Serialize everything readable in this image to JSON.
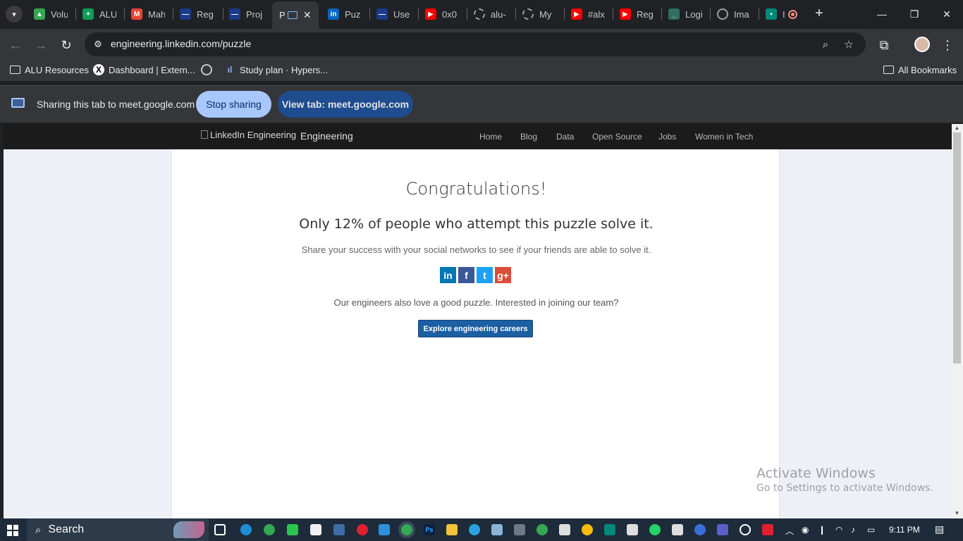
{
  "browser": {
    "tabs": [
      {
        "title": "Volu",
        "icon": "google-drive-icon",
        "color": "#34a853"
      },
      {
        "title": "ALU",
        "icon": "google-sheets-icon",
        "color": "#0f9d58"
      },
      {
        "title": "Mah",
        "icon": "gmail-icon",
        "color": "#ea4335"
      },
      {
        "title": "Reg",
        "icon": "site-icon",
        "color": "#1a3a8a"
      },
      {
        "title": "Proj",
        "icon": "site-icon",
        "color": "#1a3a8a"
      },
      {
        "title": "P",
        "icon": "present-icon",
        "color": "#8ab4f8",
        "active": true
      },
      {
        "title": "Puz",
        "icon": "linkedin-icon",
        "color": "#0a66c2"
      },
      {
        "title": "Use",
        "icon": "site-icon",
        "color": "#1a3a8a"
      },
      {
        "title": "0x0",
        "icon": "youtube-icon",
        "color": "#ff0000"
      },
      {
        "title": "alu-",
        "icon": "loading-icon",
        "color": "#9aa0a6"
      },
      {
        "title": "My",
        "icon": "loading-icon",
        "color": "#9aa0a6"
      },
      {
        "title": "#alx",
        "icon": "youtube-icon",
        "color": "#ff0000"
      },
      {
        "title": "Reg",
        "icon": "youtube-icon",
        "color": "#ff0000"
      },
      {
        "title": "Logi",
        "icon": "site-icon",
        "color": "#2f6f62"
      },
      {
        "title": "Ima",
        "icon": "globe-icon",
        "color": "#9aa0a6"
      },
      {
        "title": "I",
        "icon": "google-meet-icon",
        "color": "#00897b"
      }
    ],
    "url": "engineering.linkedin.com/puzzle",
    "bookmarks": [
      {
        "label": "ALU Resources",
        "icon": "folder-icon"
      },
      {
        "label": "Dashboard | Extern...",
        "icon": "x-icon"
      },
      {
        "label": "",
        "icon": "globe-icon"
      },
      {
        "label": "Study plan · Hypers...",
        "icon": "hyperskill-icon"
      }
    ],
    "all_bookmarks": "All Bookmarks"
  },
  "sharing": {
    "text": "Sharing this tab to meet.google.com",
    "stop_label": "Stop sharing",
    "view_label": "View tab: meet.google.com"
  },
  "site": {
    "logo_alt": "LinkedIn Engineering",
    "logo_text": "Engineering",
    "nav": [
      "Home",
      "Blog",
      "Data",
      "Open Source",
      "Jobs",
      "Women in Tech"
    ]
  },
  "page": {
    "heading": "Congratulations!",
    "stat": "Only 12% of people who attempt this puzzle solve it.",
    "share_prompt": "Share your success with your social networks to see if your friends are able to solve it.",
    "socials": [
      {
        "name": "linkedin",
        "glyph": "in",
        "color": "#0077b5"
      },
      {
        "name": "facebook",
        "glyph": "f",
        "color": "#3b5998"
      },
      {
        "name": "twitter",
        "glyph": "t",
        "color": "#1da1f2"
      },
      {
        "name": "google-plus",
        "glyph": "g+",
        "color": "#dd4b39"
      }
    ],
    "engineers_text": "Our engineers also love a good puzzle. Interested in joining our team?",
    "careers_button": "Explore engineering careers"
  },
  "watermark": {
    "line1": "Activate Windows",
    "line2": "Go to Settings to activate Windows."
  },
  "taskbar": {
    "search_label": "Search",
    "time": "9:11 PM"
  }
}
